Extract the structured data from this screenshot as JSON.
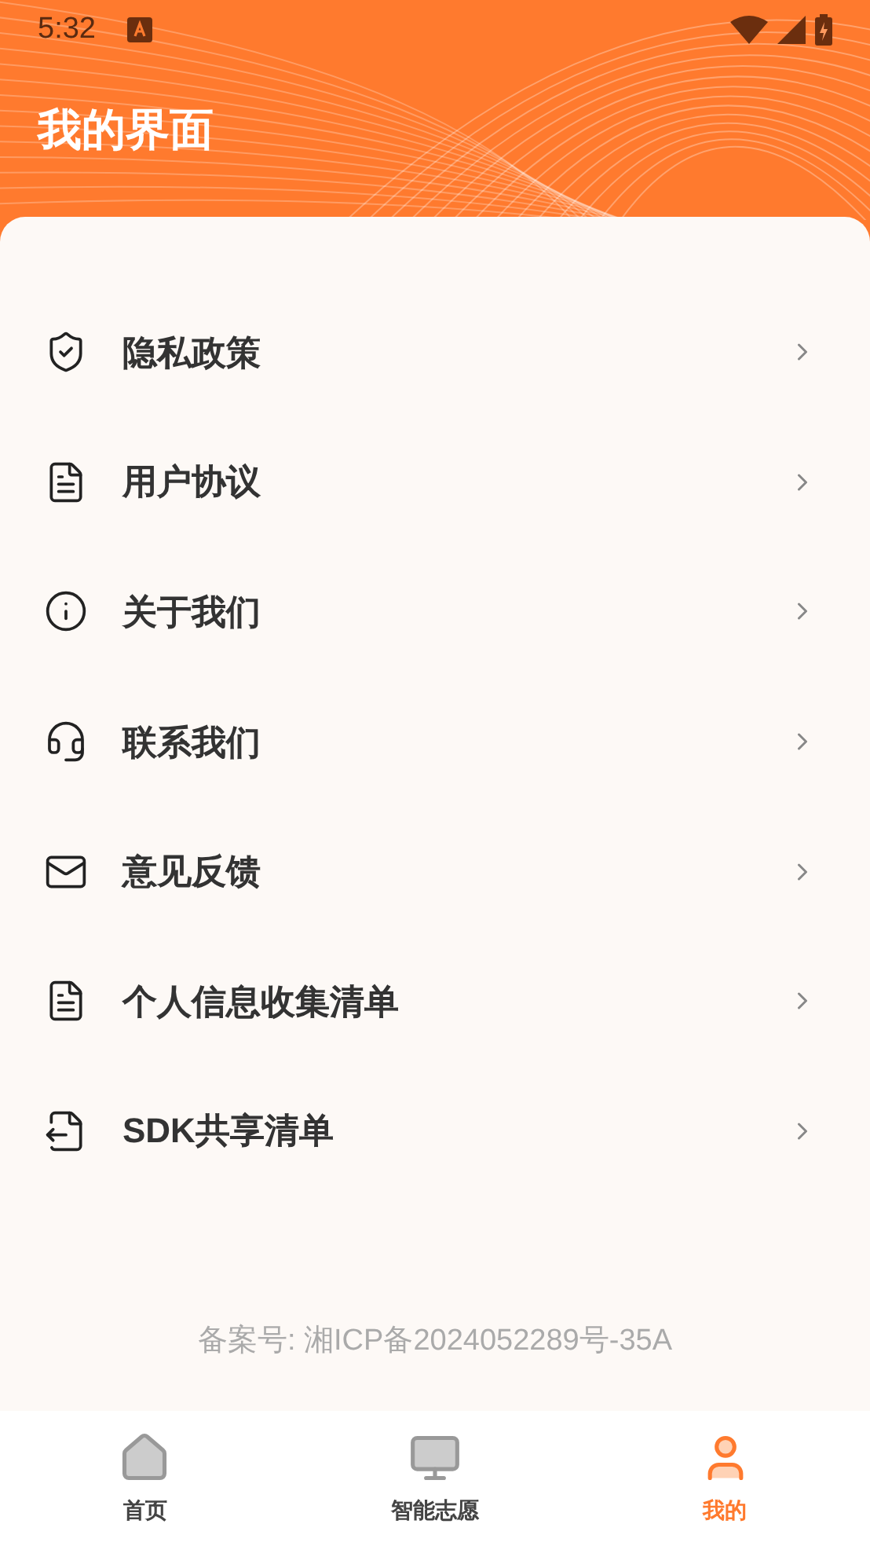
{
  "status_bar": {
    "time": "5:32"
  },
  "header": {
    "title": "我的界面"
  },
  "menu": [
    {
      "kind": "privacy",
      "label": "隐私政策"
    },
    {
      "kind": "agreement",
      "label": "用户协议"
    },
    {
      "kind": "about",
      "label": "关于我们"
    },
    {
      "kind": "contact",
      "label": "联系我们"
    },
    {
      "kind": "feedback",
      "label": "意见反馈"
    },
    {
      "kind": "info-list",
      "label": "个人信息收集清单"
    },
    {
      "kind": "sdk-list",
      "label": "SDK共享清单"
    }
  ],
  "footer": {
    "text": "备案号: 湘ICP备2024052289号-35A"
  },
  "tabs": [
    {
      "kind": "home",
      "label": "首页",
      "selected": false
    },
    {
      "kind": "screen",
      "label": "智能志愿",
      "selected": false
    },
    {
      "kind": "me",
      "label": "我的",
      "selected": true
    }
  ]
}
